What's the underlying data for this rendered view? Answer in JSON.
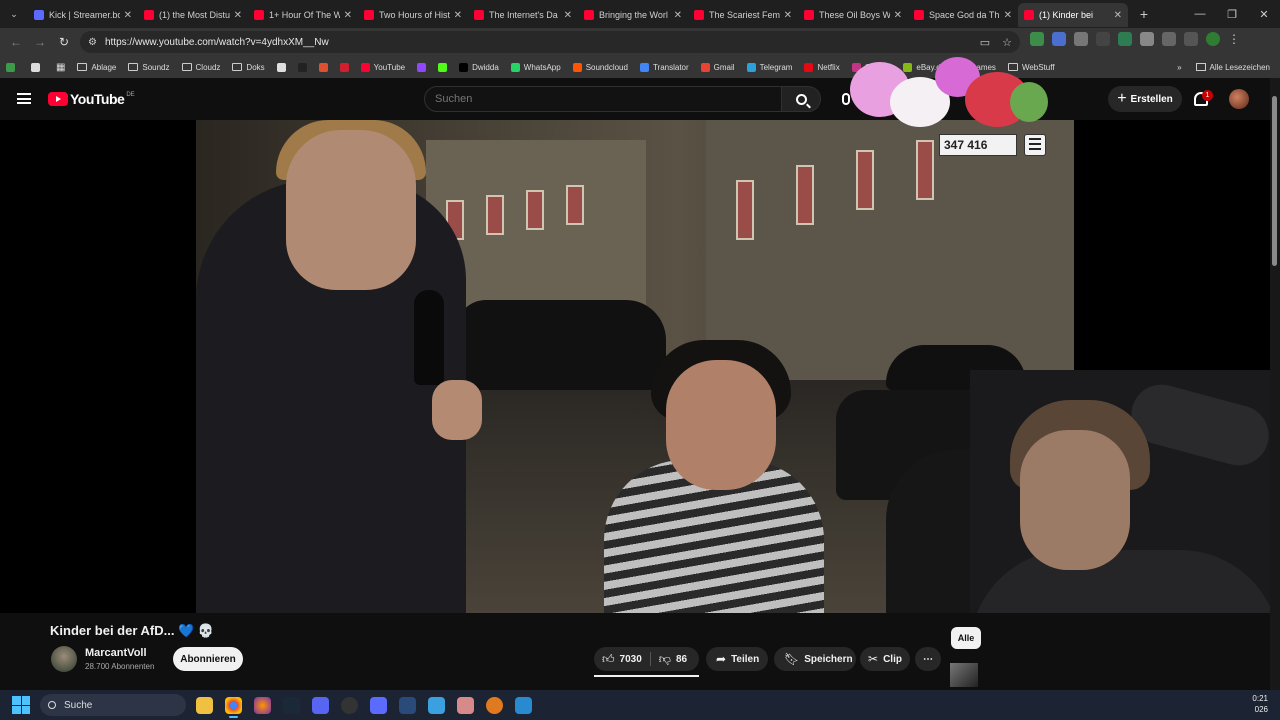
{
  "browser": {
    "tabs": [
      {
        "label": "Kick | Streamer.bo",
        "favicon": "kick",
        "active": false
      },
      {
        "label": "(1) the Most Distu",
        "favicon": "youtube",
        "active": false
      },
      {
        "label": "1+ Hour Of The W",
        "favicon": "youtube",
        "active": false
      },
      {
        "label": "Two Hours of Hist",
        "favicon": "youtube",
        "active": false
      },
      {
        "label": "The Internet's Da",
        "favicon": "youtube",
        "active": false
      },
      {
        "label": "Bringing the Worl",
        "favicon": "youtube",
        "active": false
      },
      {
        "label": "The Scariest Fema",
        "favicon": "youtube",
        "active": false
      },
      {
        "label": "These Oil Boys W",
        "favicon": "youtube",
        "active": false
      },
      {
        "label": "Space God da Th",
        "favicon": "youtube",
        "active": false
      },
      {
        "label": "(1) Kinder bei",
        "favicon": "youtube",
        "active": true
      }
    ],
    "url": "https://www.youtube.com/watch?v=4ydhxXM__Nw",
    "bookmarks": [
      {
        "label": "Ablage",
        "type": "folder"
      },
      {
        "label": "Soundz",
        "type": "folder"
      },
      {
        "label": "Cloudz",
        "type": "folder"
      },
      {
        "label": "Doks",
        "type": "folder"
      },
      {
        "label": "",
        "type": "icon",
        "color": "#e0e0e0"
      },
      {
        "label": "",
        "type": "icon",
        "color": "#222222"
      },
      {
        "label": "",
        "type": "icon",
        "color": "#e05030"
      },
      {
        "label": "",
        "type": "icon",
        "color": "#d02030"
      },
      {
        "label": "YouTube",
        "type": "icon",
        "color": "#ff0033"
      },
      {
        "label": "",
        "type": "icon",
        "color": "#9146ff"
      },
      {
        "label": "",
        "type": "icon",
        "color": "#53fc18"
      },
      {
        "label": "Dwidda",
        "type": "icon",
        "color": "#000000"
      },
      {
        "label": "WhatsApp",
        "type": "icon",
        "color": "#25d366"
      },
      {
        "label": "Soundcloud",
        "type": "icon",
        "color": "#ff5500"
      },
      {
        "label": "Translator",
        "type": "icon",
        "color": "#4285f4"
      },
      {
        "label": "Gmail",
        "type": "icon",
        "color": "#ea4335"
      },
      {
        "label": "Telegram",
        "type": "icon",
        "color": "#2aa1da"
      },
      {
        "label": "Netflix",
        "type": "icon",
        "color": "#e50914"
      },
      {
        "label": "Gramm",
        "type": "icon",
        "color": "#c13584"
      },
      {
        "label": "eBay.de",
        "type": "icon",
        "color": "#86b817"
      },
      {
        "label": "Games",
        "type": "icon",
        "color": "#5865f2"
      },
      {
        "label": "WebStuff",
        "type": "folder"
      }
    ],
    "all_bookmarks": "Alle Lesezeichen"
  },
  "youtube": {
    "logo_text": "YouTube",
    "country": "DE",
    "search_placeholder": "Suchen",
    "create_label": "Erstellen",
    "notification_count": "1"
  },
  "overlay": {
    "counter": "347 416"
  },
  "video": {
    "title": "Kinder bei der AfD... 💙 💀",
    "channel": "MarcantVoll",
    "subscribers": "28.700 Abonnenten",
    "subscribe_label": "Abonnieren",
    "likes": "7030",
    "dislikes": "86",
    "share_label": "Teilen",
    "save_label": "Speichern",
    "clip_label": "Clip",
    "filter_label": "Alle"
  },
  "taskbar": {
    "search_label": "Suche",
    "time": "0:21",
    "date": "026"
  }
}
